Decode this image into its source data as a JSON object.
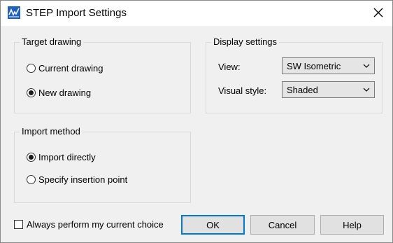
{
  "window": {
    "title": "STEP Import Settings"
  },
  "target_drawing": {
    "legend": "Target drawing",
    "options": [
      {
        "label": "Current drawing",
        "checked": false
      },
      {
        "label": "New drawing",
        "checked": true
      }
    ]
  },
  "import_method": {
    "legend": "Import method",
    "options": [
      {
        "label": "Import directly",
        "checked": true
      },
      {
        "label": "Specify insertion point",
        "checked": false
      }
    ]
  },
  "display_settings": {
    "legend": "Display settings",
    "view_label": "View:",
    "view_value": "SW Isometric",
    "visual_style_label": "Visual style:",
    "visual_style_value": "Shaded"
  },
  "footer": {
    "always_perform_label": "Always perform my current choice",
    "always_perform_checked": false,
    "ok_label": "OK",
    "cancel_label": "Cancel",
    "help_label": "Help"
  },
  "colors": {
    "accent": "#0078d7",
    "icon_blue": "#1f5fbf"
  },
  "icons": {
    "app": "step-import-app-icon",
    "close": "close-icon",
    "dropdown": "chevron-down-icon"
  }
}
